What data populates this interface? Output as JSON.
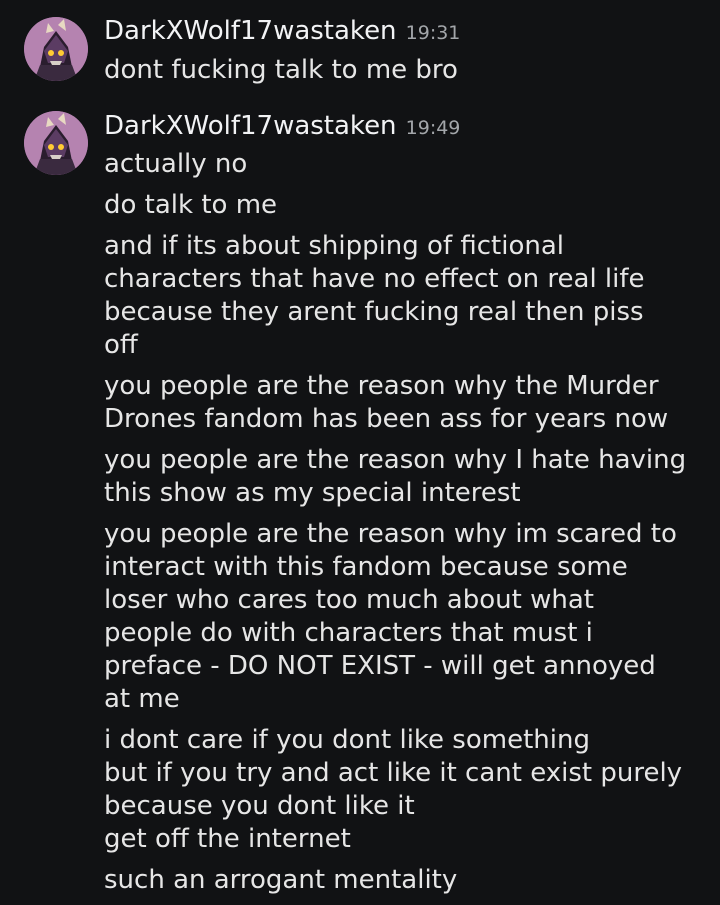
{
  "messages": [
    {
      "username": "DarkXWolf17wastaken",
      "timestamp": "19:31",
      "blocks": [
        [
          "dont fucking talk to me bro"
        ]
      ]
    },
    {
      "username": "DarkXWolf17wastaken",
      "timestamp": "19:49",
      "blocks": [
        [
          "actually no"
        ],
        [
          "do talk to me"
        ],
        [
          "and if its about shipping of fictional",
          "characters that have no effect on real life",
          "because they arent fucking real then piss",
          "off"
        ],
        [
          "you people are the reason why the Murder",
          "Drones fandom has been ass for years now"
        ],
        [
          "you people are the reason why I hate having",
          "this show as my special interest"
        ],
        [
          "you people are the reason why im scared to",
          "interact with this fandom because some",
          "loser who cares too much about what",
          "people do with characters that must i",
          "preface - DO NOT EXIST - will get annoyed",
          "at me"
        ],
        [
          "i dont care if you dont like something",
          "but if you try and act like it cant exist purely",
          "because you dont like it",
          "get off the internet"
        ],
        [
          "such an arrogant mentality"
        ]
      ]
    }
  ]
}
